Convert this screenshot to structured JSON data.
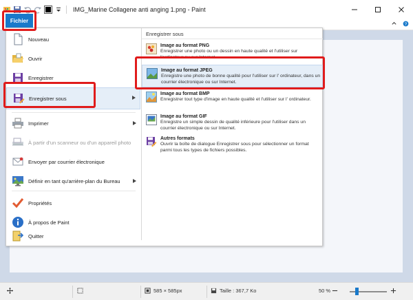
{
  "window": {
    "title": "IMG_Marine Collagene anti anging 1.png - Paint"
  },
  "ribbon": {
    "file_tab_label": "Fichier"
  },
  "menu": {
    "items": [
      {
        "label": "Nouveau",
        "icon": "new-file-icon"
      },
      {
        "label": "Ouvrir",
        "icon": "open-folder-icon"
      },
      {
        "label": "Enregistrer",
        "icon": "save-disk-icon"
      },
      {
        "label": "Enregistrer sous",
        "icon": "save-as-icon"
      },
      {
        "label": "Imprimer",
        "icon": "printer-icon"
      },
      {
        "label": "À partir d'un scanneur ou d'un appareil photo",
        "icon": "scanner-icon"
      },
      {
        "label": "Envoyer par courrier électronique",
        "icon": "email-icon"
      },
      {
        "label": "Définir en tant qu'arrière-plan du Bureau",
        "icon": "desktop-background-icon"
      },
      {
        "label": "Propriétés",
        "icon": "checkmark-icon"
      },
      {
        "label": "À propos de Paint",
        "icon": "info-icon"
      },
      {
        "label": "Quitter",
        "icon": "exit-icon"
      }
    ],
    "submenu": {
      "heading": "Enregistrer sous",
      "options": [
        {
          "title": "Image au format PNG",
          "desc": "Enregistrer une photo ou un dessin en haute qualité et l'utiliser sur l'ordinateur ou sur Internet."
        },
        {
          "title": "Image au format JPEG",
          "desc": "Enregistre une photo de bonne qualité pour l'utiliser sur l' ordinateur, dans un courrier électronique ou sur Internet."
        },
        {
          "title": "Image au format BMP",
          "desc": "Enregistrer tout type d'image en haute qualité et l'utiliser sur l' ordinateur."
        },
        {
          "title": "Image au format GIF",
          "desc": "Enregistre un simple dessin de qualité inférieure pour l'utiliser dans un courrier électronique ou sur Internet."
        },
        {
          "title": "Autres formats",
          "desc": "Ouvrir la boîte de dialogue Enregistrer sous pour sélectionner un format parmi tous les types de fichiers possibles."
        }
      ]
    }
  },
  "statusbar": {
    "dimensions": "585 × 585px",
    "size": "Taille : 367,7 Ko",
    "zoom": "50 %",
    "zoom_fraction": 0.5
  },
  "colors": {
    "accent": "#1979ca",
    "highlight_box": "#e01b1b",
    "canvas_bg": "#cfd9e8"
  }
}
